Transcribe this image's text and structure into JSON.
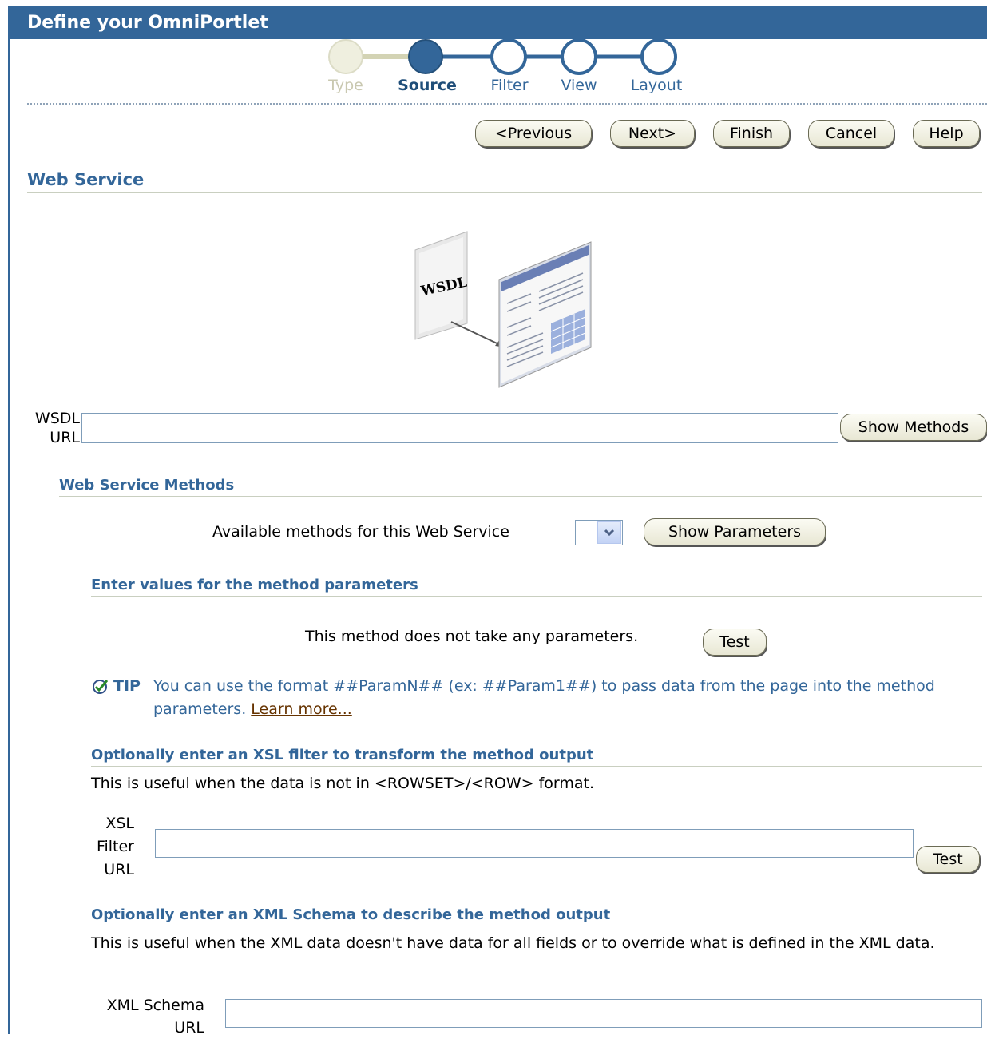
{
  "window": {
    "title": "Define your OmniPortlet"
  },
  "train": {
    "steps": [
      {
        "label": "Type",
        "state": "visited"
      },
      {
        "label": "Source",
        "state": "current"
      },
      {
        "label": "Filter",
        "state": "unvisited"
      },
      {
        "label": "View",
        "state": "unvisited"
      },
      {
        "label": "Layout",
        "state": "unvisited"
      }
    ]
  },
  "nav": {
    "previous": "<Previous",
    "next": "Next>",
    "finish": "Finish",
    "cancel": "Cancel",
    "help": "Help"
  },
  "section": {
    "title": "Web Service"
  },
  "illustration": {
    "text": "WSDL"
  },
  "wsdl": {
    "label_line1": "WSDL",
    "label_line2": "URL",
    "value": "",
    "show_methods": "Show Methods"
  },
  "methods": {
    "title": "Web Service Methods",
    "available_label": "Available methods for this Web Service",
    "selected": "",
    "show_parameters": "Show Parameters"
  },
  "parameters": {
    "title": "Enter values for the method parameters",
    "message": "This method does not take any parameters.",
    "test": "Test"
  },
  "tip": {
    "label": "TIP",
    "text": "You can use the format ##ParamN## (ex: ##Param1##) to pass data from the page into the method parameters.",
    "link": "Learn more..."
  },
  "xsl": {
    "title": "Optionally enter an XSL filter to transform the method output",
    "description": "This is useful when the data is not in <ROWSET>/<ROW> format.",
    "label_line1": "XSL",
    "label_line2": "Filter",
    "label_line3": "URL",
    "value": "",
    "test": "Test"
  },
  "schema": {
    "title": "Optionally enter an XML Schema to describe the method output",
    "description": "This is useful when the XML data doesn't have data for all fields or to override what is defined in the XML data.",
    "label_line1": "XML Schema",
    "label_line2": "URL",
    "value": ""
  },
  "colors": {
    "brand": "#336699",
    "visited_step": "#e6e6d0",
    "current_step": "#336699"
  }
}
